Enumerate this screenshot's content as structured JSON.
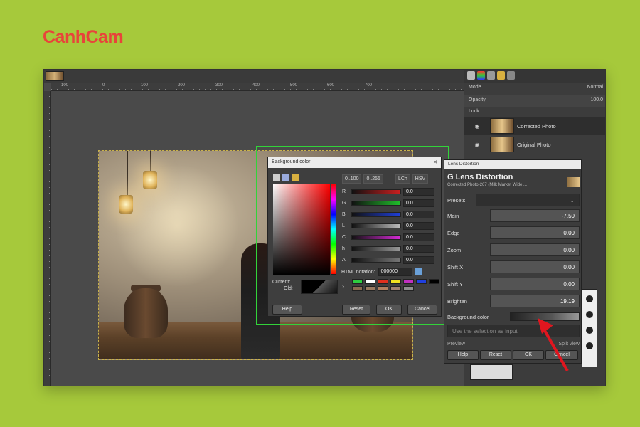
{
  "brand": {
    "name": "CanhCam"
  },
  "ruler": {
    "ticks": [
      "100",
      "0",
      "100",
      "200",
      "300",
      "400",
      "500",
      "600",
      "700"
    ]
  },
  "layers_panel": {
    "mode_label": "Mode",
    "mode_value": "Normal",
    "opacity_label": "Opacity",
    "opacity_value": "100.0",
    "lock_label": "Lock:",
    "layers": [
      {
        "name": "Corrected Photo"
      },
      {
        "name": "Original Photo"
      }
    ]
  },
  "bg_color_dialog": {
    "title": "Background color",
    "range_buttons": [
      "0..100",
      "0..255"
    ],
    "mode_buttons": [
      "LCh",
      "HSV"
    ],
    "sliders": [
      {
        "label": "R",
        "value": "0.0",
        "color": "#cc1f1f"
      },
      {
        "label": "G",
        "value": "0.0",
        "color": "#1fbf2a"
      },
      {
        "label": "B",
        "value": "0.0",
        "color": "#1f3fd8"
      },
      {
        "label": "L",
        "value": "0.0",
        "color": "#bbbbbb"
      },
      {
        "label": "C",
        "value": "0.0",
        "color": "#d62bd6"
      },
      {
        "label": "h",
        "value": "0.0",
        "color": "#999999"
      },
      {
        "label": "A",
        "value": "0.0",
        "color": "#777777"
      }
    ],
    "html_notation_label": "HTML notation:",
    "html_notation_value": "000000",
    "current_label": "Current:",
    "old_label": "Old:",
    "swatches": [
      "#2ecc40",
      "#ffffff",
      "#e0301e",
      "#f0e020",
      "#c030c0",
      "#2040e0",
      "#000000",
      "#8a6a50",
      "#9a7a60",
      "#b08060",
      "#a08070",
      "#8f8f8f"
    ],
    "buttons": {
      "help": "Help",
      "reset": "Reset",
      "ok": "OK",
      "cancel": "Cancel"
    }
  },
  "lens_dialog": {
    "window_title": "Lens Distortion",
    "heading": "Lens Distortion",
    "subtitle": "Corrected Photo-267 (Milk Market Wide ...",
    "presets_label": "Presets:",
    "fields": [
      {
        "name": "Main",
        "value": "-7.50"
      },
      {
        "name": "Edge",
        "value": "0.00"
      },
      {
        "name": "Zoom",
        "value": "0.00"
      },
      {
        "name": "Shift X",
        "value": "0.00"
      },
      {
        "name": "Shift Y",
        "value": "0.00"
      },
      {
        "name": "Brighten",
        "value": "19.19"
      }
    ],
    "background_color_label": "Background color",
    "use_selection_label": "Use the selection as input",
    "preview_label": "Preview",
    "split_view_label": "Split view",
    "buttons": {
      "help": "Help",
      "reset": "Reset",
      "ok": "OK",
      "cancel": "Cancel"
    }
  }
}
